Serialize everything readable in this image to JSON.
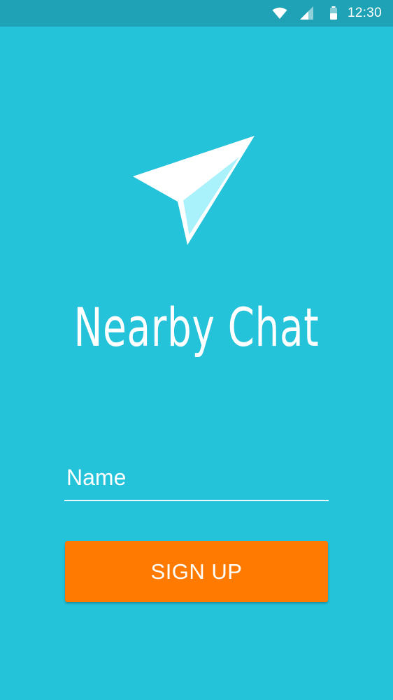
{
  "status_bar": {
    "time": "12:30",
    "icons": [
      "wifi-icon",
      "cell-signal-icon",
      "battery-icon"
    ],
    "background_color": "#1fa2b5"
  },
  "logo": {
    "icon": "paper-plane-icon"
  },
  "app": {
    "title": "Nearby Chat",
    "background_color": "#25c3da"
  },
  "form": {
    "name_placeholder": "Name",
    "name_value": "",
    "signup_label": "SIGN UP",
    "signup_color": "#ff7a00"
  }
}
